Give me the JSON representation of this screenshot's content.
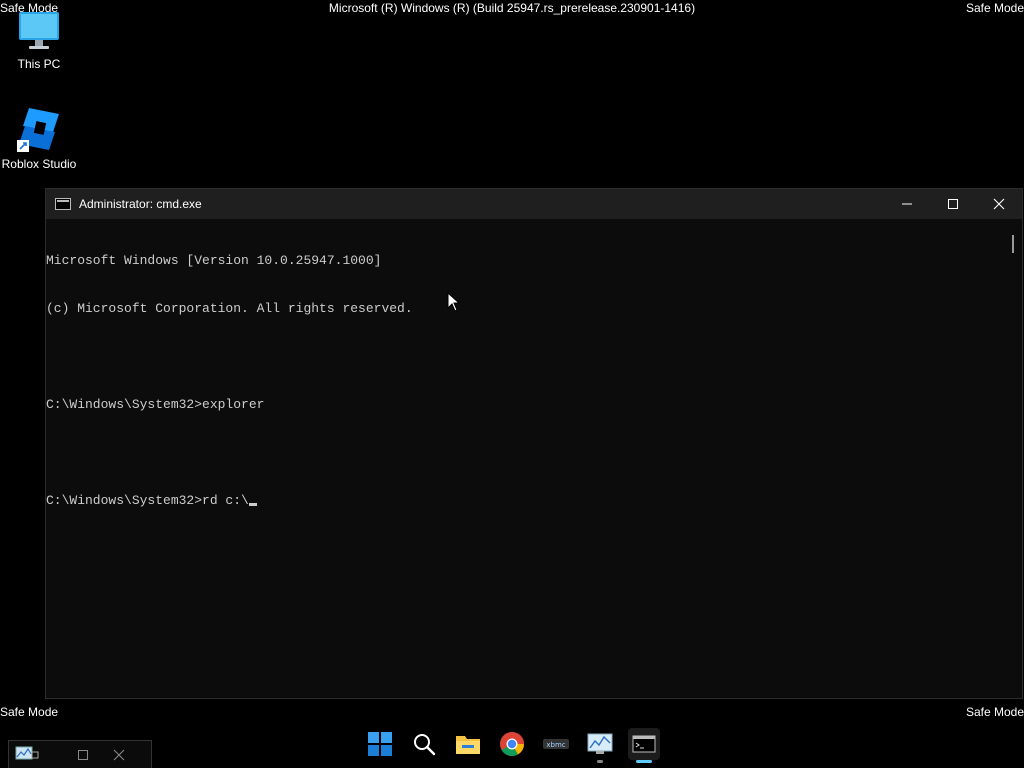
{
  "overlay": {
    "safe_mode_top_left": "Safe Mode",
    "safe_mode_top_right": "Safe Mode",
    "safe_mode_bottom_left": "Safe Mode",
    "safe_mode_bottom_right": "Safe Mode",
    "build_string": "Microsoft (R) Windows (R) (Build 25947.rs_prerelease.230901-1416)"
  },
  "desktop": {
    "icons": [
      {
        "label": "This PC",
        "icon": "monitor-icon"
      },
      {
        "label": "Roblox Studio",
        "icon": "roblox-studio-icon"
      }
    ]
  },
  "window": {
    "title": "Administrator: cmd.exe",
    "console_lines": [
      "Microsoft Windows [Version 10.0.25947.1000]",
      "(c) Microsoft Corporation. All rights reserved.",
      "",
      "C:\\Windows\\System32>explorer",
      "",
      "C:\\Windows\\System32>rd c:\\"
    ]
  },
  "taskbar": {
    "apps": [
      "start-icon",
      "search-icon",
      "file-explorer-icon",
      "chrome-icon",
      "xbmc-icon",
      "resource-monitor-icon",
      "cmd-icon"
    ],
    "active_app": "cmd-icon"
  },
  "colors": {
    "desktop_bg": "#000000",
    "console_bg": "#0c0c0c",
    "console_text": "#cccccc",
    "accent": "#60cdff"
  }
}
